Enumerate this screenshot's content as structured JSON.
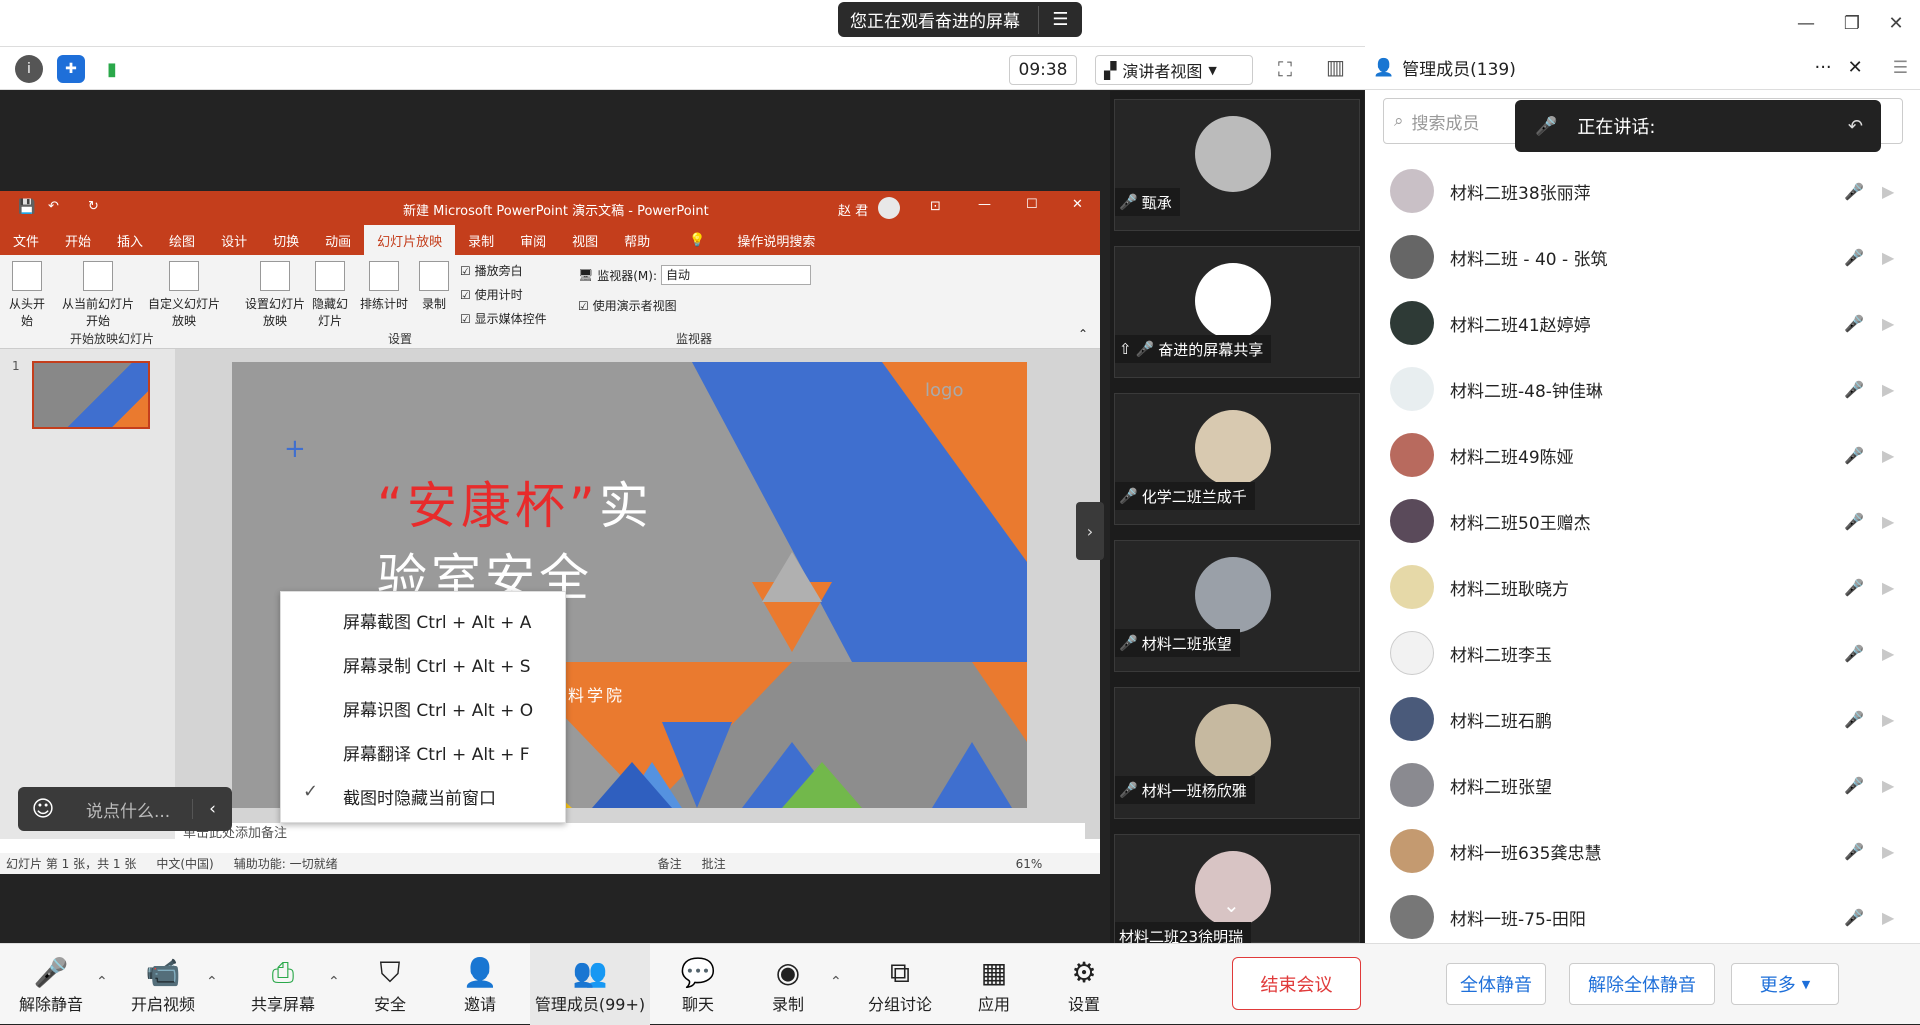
{
  "window": {
    "share_banner": "您正在观看奋进的屏幕",
    "minimize": "—",
    "restore": "❐",
    "close": "✕"
  },
  "toolbar": {
    "timer": "09:38",
    "presenter_view": "演讲者视图",
    "info_icon": "i",
    "shield_icon": "shield",
    "signal_icon": "signal"
  },
  "ppt": {
    "title": "新建 Microsoft PowerPoint 演示文稿 - PowerPoint",
    "user": "赵 君",
    "tabs": [
      "文件",
      "开始",
      "插入",
      "绘图",
      "设计",
      "切换",
      "动画",
      "幻灯片放映",
      "录制",
      "审阅",
      "视图",
      "帮助",
      "操作说明搜索"
    ],
    "active_tab": "幻灯片放映",
    "ribbon": {
      "from_start": "从头开始",
      "from_current": "从当前幻灯片开始",
      "custom_show": "自定义幻灯片放映",
      "group1": "开始放映幻灯片",
      "setup_show": "设置幻灯片放映",
      "hide_slide": "隐藏幻灯片",
      "rehearse": "排练计时",
      "record": "录制",
      "cb_narration": "播放旁白",
      "cb_timing": "使用计时",
      "cb_media": "显示媒体控件",
      "group2": "设置",
      "monitor_label": "监视器(M):",
      "monitor_value": "自动",
      "cb_presenter": "使用演示者视图",
      "group3": "监视器"
    },
    "slide_number": "1",
    "slide_title_quote": "“安康杯”",
    "slide_title_rest": "实",
    "slide_title_line2": "验室安全",
    "slide_logo": "logo",
    "slide_school": "化学与材料学院",
    "notes_placeholder": "单击此处添加备注",
    "status": {
      "slide_info": "幻灯片 第 1 张，共 1 张",
      "lang": "中文(中国)",
      "accessibility": "辅助功能: 一切就绪",
      "notes": "备注",
      "comments": "批注",
      "zoom": "61%"
    }
  },
  "context_menu": {
    "items": [
      "屏幕截图 Ctrl + Alt + A",
      "屏幕录制 Ctrl + Alt + S",
      "屏幕识图 Ctrl + Alt + O",
      "屏幕翻译 Ctrl + Alt + F",
      "截图时隐藏当前窗口"
    ]
  },
  "chat": {
    "placeholder": "说点什么..."
  },
  "videos": [
    {
      "name": "甄承"
    },
    {
      "name": "奋进的屏幕共享"
    },
    {
      "name": "化学二班兰成千"
    },
    {
      "name": "材料二班张望"
    },
    {
      "name": "材料一班杨欣雅"
    },
    {
      "name": "材料二班23徐明瑞"
    }
  ],
  "panel": {
    "title": "管理成员(139)",
    "search_placeholder": "搜索成员",
    "speaking": "正在讲话:",
    "members": [
      "材料二班38张丽萍",
      "材料二班 - 40 - 张筑",
      "材料二班41赵婷婷",
      "材料二班-48-钟佳琳",
      "材料二班49陈娅",
      "材料二班50王赠杰",
      "材料二班耿晓方",
      "材料二班李玉",
      "材料二班石鹏",
      "材料二班张望",
      "材料一班635龚忠慧",
      "材料一班-75-田阳"
    ],
    "mute_all": "全体静音",
    "unmute_all": "解除全体静音",
    "more": "更多"
  },
  "bottom": {
    "unmute": "解除静音",
    "video": "开启视频",
    "share": "共享屏幕",
    "security": "安全",
    "invite": "邀请",
    "members": "管理成员(99+)",
    "chat": "聊天",
    "record": "录制",
    "breakout": "分组讨论",
    "apps": "应用",
    "settings": "设置",
    "end": "结束会议"
  }
}
